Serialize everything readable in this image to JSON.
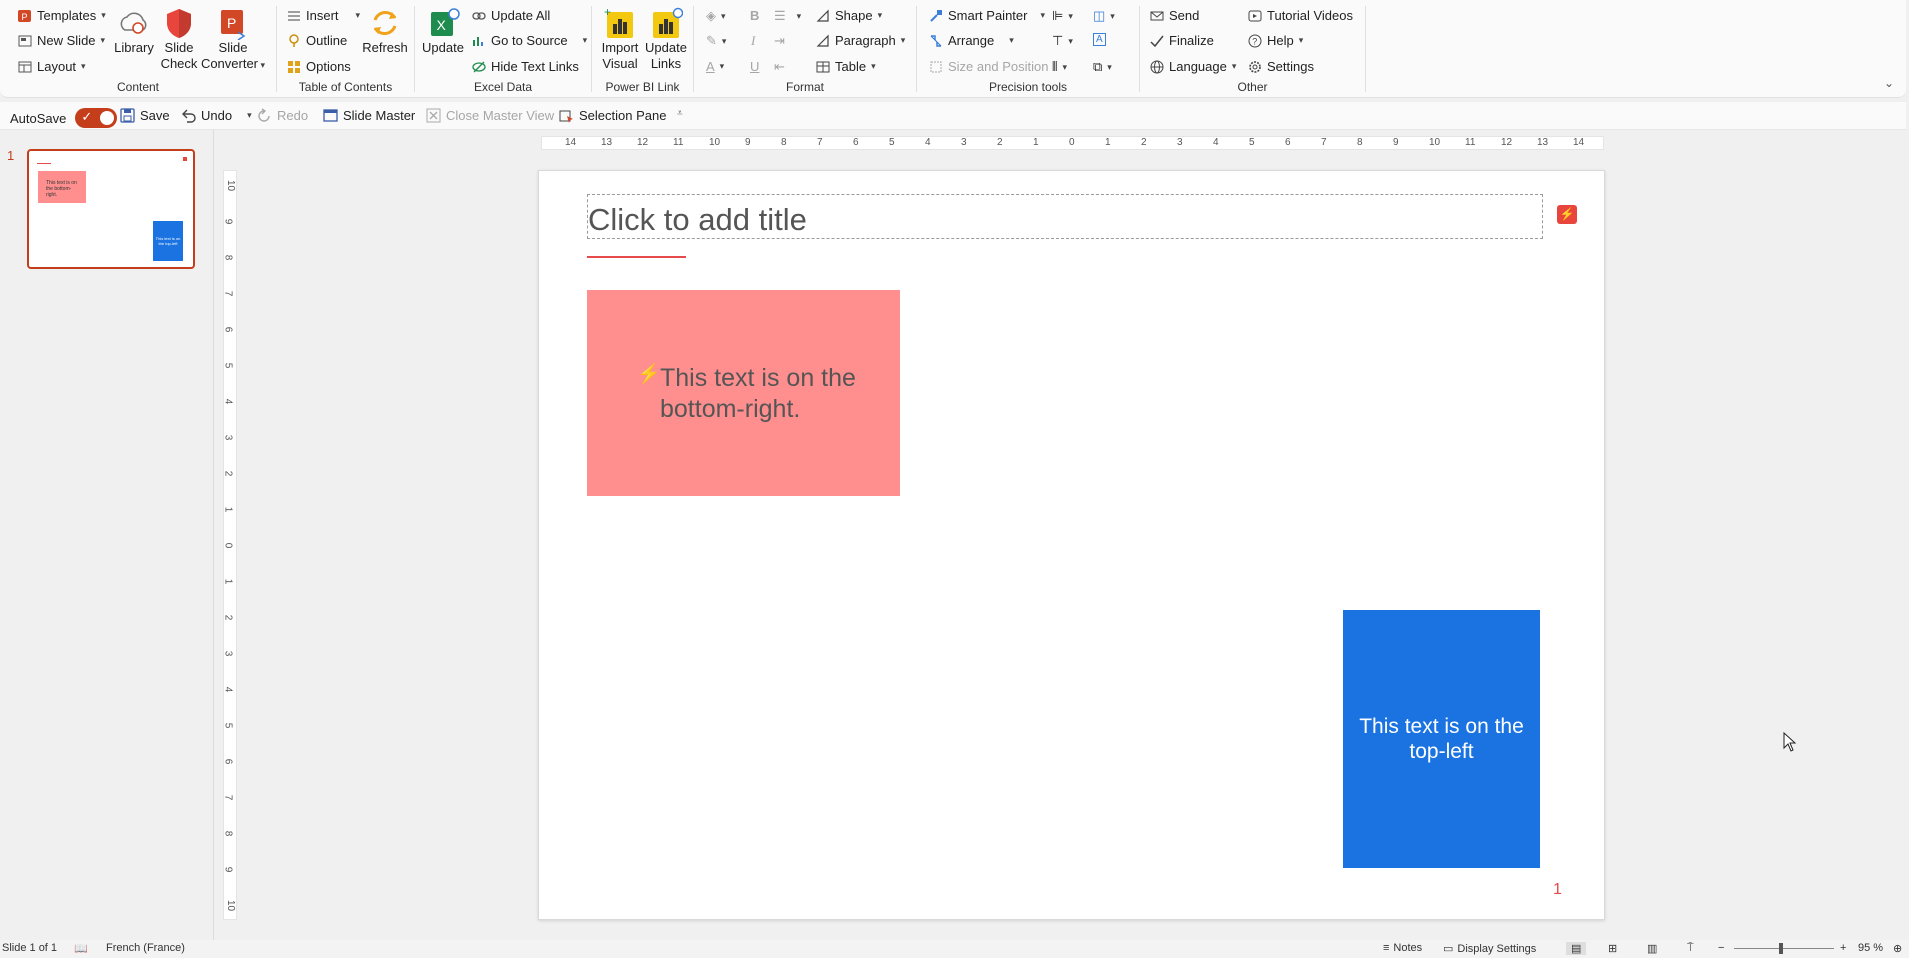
{
  "ribbon": {
    "content": {
      "label": "Content",
      "templates": "Templates",
      "new_slide": "New Slide",
      "layout": "Layout",
      "library": "Library",
      "slide_check": [
        "Slide",
        "Check"
      ],
      "slide_converter": [
        "Slide",
        "Converter"
      ]
    },
    "toc": {
      "label": "Table of Contents",
      "insert": "Insert",
      "outline": "Outline",
      "options": "Options",
      "refresh": "Refresh"
    },
    "excel": {
      "label": "Excel Data",
      "update": "Update",
      "update_all": "Update All",
      "go_to_source": "Go to Source",
      "hide_text_links": "Hide Text Links"
    },
    "powerbi": {
      "label": "Power BI Link",
      "import_visual": [
        "Import",
        "Visual"
      ],
      "update_links": [
        "Update",
        "Links"
      ]
    },
    "format": {
      "label": "Format",
      "shape": "Shape",
      "paragraph": "Paragraph",
      "table": "Table"
    },
    "precision": {
      "label": "Precision tools",
      "smart_painter": "Smart Painter",
      "arrange": "Arrange",
      "size_position": "Size and Position"
    },
    "other": {
      "label": "Other",
      "send": "Send",
      "finalize": "Finalize",
      "language": "Language",
      "tutorial_videos": "Tutorial Videos",
      "help": "Help",
      "settings": "Settings"
    }
  },
  "qat": {
    "autosave": "AutoSave",
    "save": "Save",
    "undo": "Undo",
    "redo": "Redo",
    "slide_master": "Slide Master",
    "close_master_view": "Close Master View",
    "selection_pane": "Selection Pane"
  },
  "thumbnail": {
    "number": "1",
    "red_text": "This text is on the bottom-right.",
    "blue_text": "This text is on the top-left"
  },
  "ruler": {
    "h_ticks": [
      "14",
      "13",
      "12",
      "11",
      "10",
      "9",
      "8",
      "7",
      "6",
      "5",
      "4",
      "3",
      "2",
      "1",
      "0",
      "1",
      "2",
      "3",
      "4",
      "5",
      "6",
      "7",
      "8",
      "9",
      "10",
      "11",
      "12",
      "13",
      "14"
    ],
    "v_ticks": [
      "10",
      "9",
      "8",
      "7",
      "6",
      "5",
      "4",
      "3",
      "2",
      "1",
      "0",
      "1",
      "2",
      "3",
      "4",
      "5",
      "6",
      "7",
      "8",
      "9",
      "10"
    ]
  },
  "slide": {
    "title_placeholder": "Click to add title",
    "red_box_text": "This text is on the bottom-right.",
    "blue_box_text": "This text is on the top-left",
    "page_number": "1"
  },
  "status": {
    "slide_info": "Slide 1 of 1",
    "language": "French (France)",
    "notes": "Notes",
    "display_settings": "Display Settings",
    "zoom": "95 %"
  },
  "colors": {
    "accent_orange": "#c43e1c",
    "red_shape": "#ff8f8f",
    "blue_shape": "#1a73e0",
    "title_underline": "#e64a4a",
    "badge_red": "#e8453c"
  }
}
